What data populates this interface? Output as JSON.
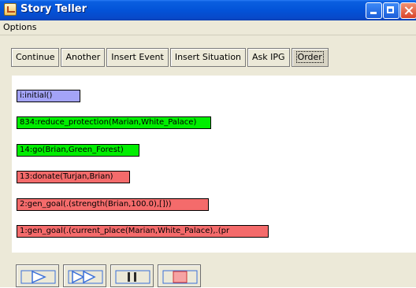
{
  "window": {
    "title": "Story Teller",
    "icon": "app-icon"
  },
  "menu": {
    "items": [
      "Options"
    ]
  },
  "toolbar": {
    "buttons": [
      "Continue",
      "Another",
      "Insert Event",
      "Insert Situation",
      "Ask IPG",
      "Order"
    ]
  },
  "events": [
    {
      "label": "i:initial()",
      "color": "#a3a3f7"
    },
    {
      "label": "834:reduce_protection(Marian,White_Palace)",
      "color": "#00ee00"
    },
    {
      "label": "14:go(Brian,Green_Forest)",
      "color": "#00ee00"
    },
    {
      "label": "13:donate(Turjan,Brian)",
      "color": "#f46b6b"
    },
    {
      "label": "2:gen_goal(.(strength(Brian,100.0),[]))",
      "color": "#f46b6b"
    },
    {
      "label": "1:gen_goal(.(current_place(Marian,White_Palace),.(pr",
      "color": "#f46b6b"
    }
  ],
  "controls": [
    "play-icon",
    "fast-forward-icon",
    "pause-icon",
    "stop-icon"
  ],
  "colors": {
    "title_bar": "#0353d8",
    "control_icon": "#3a6fd8",
    "stop_fill": "#f6a3a3"
  }
}
